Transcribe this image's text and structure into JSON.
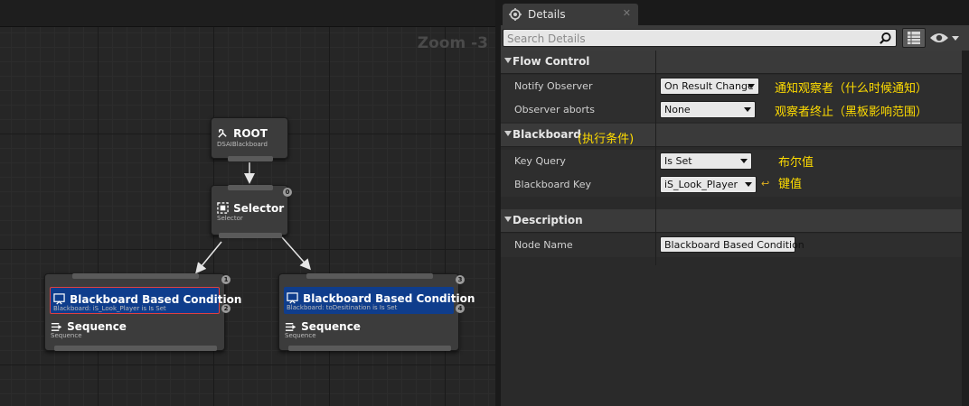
{
  "graph": {
    "zoom_label": "Zoom -3",
    "nodes": {
      "root": {
        "title": "ROOT",
        "subtitle": "DSAIBlackboard"
      },
      "selector": {
        "title": "Selector",
        "subtitle": "Selector",
        "index": "0"
      },
      "left": {
        "decorator_title": "Blackboard Based Condition",
        "decorator_sub": "Blackboard: iS_Look_Player is Is Set",
        "task_title": "Sequence",
        "task_sub": "Sequence",
        "index_top": "1",
        "index_bottom": "2"
      },
      "right": {
        "decorator_title": "Blackboard Based Condition",
        "decorator_sub": "Blackboard: toDesitination is Is Set",
        "task_title": "Sequence",
        "task_sub": "Sequence",
        "index_top": "3",
        "index_bottom": "4"
      }
    }
  },
  "details": {
    "tab_label": "Details",
    "search_placeholder": "Search Details",
    "categories": {
      "flow_control": {
        "label": "Flow Control",
        "notify_observer": {
          "name": "Notify Observer",
          "value": "On Result Change",
          "note": "通知观察者（什么时候通知）"
        },
        "observer_aborts": {
          "name": "Observer aborts",
          "value": "None",
          "note": "观察者终止（黑板影响范围）"
        }
      },
      "blackboard": {
        "label": "Blackboard",
        "note": "(执行条件)",
        "key_query": {
          "name": "Key Query",
          "value": "Is Set",
          "note": "布尔值"
        },
        "blackboard_key": {
          "name": "Blackboard Key",
          "value": "iS_Look_Player",
          "note": "键值"
        }
      },
      "description": {
        "label": "Description",
        "node_name": {
          "name": "Node Name",
          "value": "Blackboard Based Condition"
        }
      }
    }
  },
  "colors": {
    "decorator_blue": "#0f3d8c",
    "note_yellow": "#ffdc00",
    "selected_red": "#e04040"
  }
}
